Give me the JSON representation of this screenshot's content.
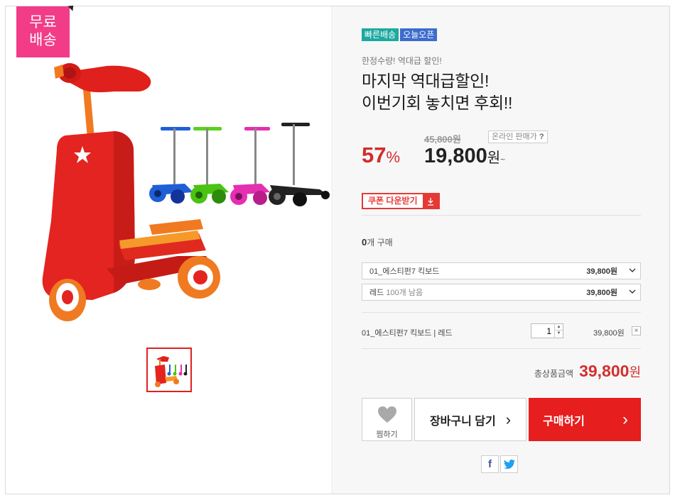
{
  "badge": {
    "line1": "무료",
    "line2": "배송"
  },
  "product": {
    "tags": [
      "빠른배송",
      "오늘오픈"
    ],
    "subtitle": "한정수량! 역대급 할인!",
    "title_line1": "마지막 역대급할인!",
    "title_line2": "이번기회 놓치면 후회!!"
  },
  "pricing": {
    "discount_num": "57",
    "discount_pct": "%",
    "original_price": "45,800원",
    "online_label": "온라인 판매가",
    "online_help": "?",
    "sale_price": "19,800",
    "sale_unit": "원",
    "sale_tilde": "~"
  },
  "coupon": {
    "label": "쿠폰 다운받기",
    "icon": "download-icon"
  },
  "purchase": {
    "count": "0",
    "count_suffix": "개 구매"
  },
  "options": [
    {
      "name": "01_에스티펀7 킥보드",
      "extra": "",
      "price": "39,800원"
    },
    {
      "name": "레드",
      "extra": "100개 남음",
      "price": "39,800원"
    }
  ],
  "selected": {
    "name": "01_에스티펀7 킥보드 | 레드",
    "qty": "1",
    "price": "39,800원",
    "remove": "×"
  },
  "total": {
    "label": "총상품금액",
    "amount": "39,800",
    "unit": "원"
  },
  "actions": {
    "wish_label": "찜하기",
    "cart_label": "장바구니 담기",
    "cart_arrow": "›",
    "buy_label": "구매하기",
    "buy_arrow": "›"
  },
  "share": {
    "facebook": "f",
    "twitter": "twitter-icon"
  },
  "colors": {
    "accent_red": "#e61e1e",
    "badge_pink": "#f23c87",
    "tag_teal": "#1ca9a0",
    "tag_blue": "#3c6ccc"
  }
}
